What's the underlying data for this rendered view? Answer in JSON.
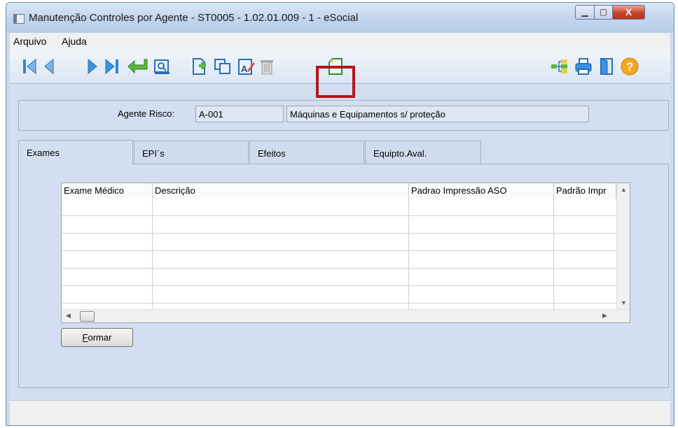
{
  "window": {
    "title": "Manutenção Controles por Agente - ST0005 - 1.02.01.009 - 1 - eSocial",
    "controls": {
      "minimize": "▁",
      "maximize": "▢",
      "close": "X"
    }
  },
  "menu": {
    "items": [
      "Arquivo",
      "Ajuda"
    ]
  },
  "toolbar": {
    "buttons": [
      "first-record-icon",
      "previous-record-icon",
      "next-record-icon",
      "last-record-icon",
      "confirm-icon",
      "preview-icon",
      "new-record-icon",
      "copy-record-icon",
      "edit-text-icon",
      "delete-icon",
      "new-document-icon",
      "tree-view-icon",
      "print-icon",
      "exit-door-icon",
      "help-icon"
    ],
    "highlighted": "new-document-icon",
    "highlight_color": "#b3171d"
  },
  "agent": {
    "label": "Agente Risco:",
    "code": "A-001",
    "description": "Máquinas e Equipamentos s/ proteção"
  },
  "tabs": [
    "Exames",
    "EPI´s",
    "Efeitos",
    "Equipto.Aval."
  ],
  "active_tab": "Exames",
  "grid": {
    "columns": [
      "Exame Médico",
      "Descrição",
      "Padrao Impressão ASO",
      "Padrão Impr"
    ],
    "rows": [
      [
        "",
        "",
        "",
        ""
      ],
      [
        "",
        "",
        "",
        ""
      ],
      [
        "",
        "",
        "",
        ""
      ],
      [
        "",
        "",
        "",
        ""
      ],
      [
        "",
        "",
        "",
        ""
      ],
      [
        "",
        "",
        "",
        ""
      ],
      [
        "",
        "",
        "",
        ""
      ]
    ]
  },
  "buttons": {
    "formar_prefix": "",
    "formar_underlined": "F",
    "formar_rest": "ormar"
  },
  "colors": {
    "window_bg": "#d3dff0",
    "title_bg": "#c3d6ee",
    "close": "#c7432b"
  }
}
